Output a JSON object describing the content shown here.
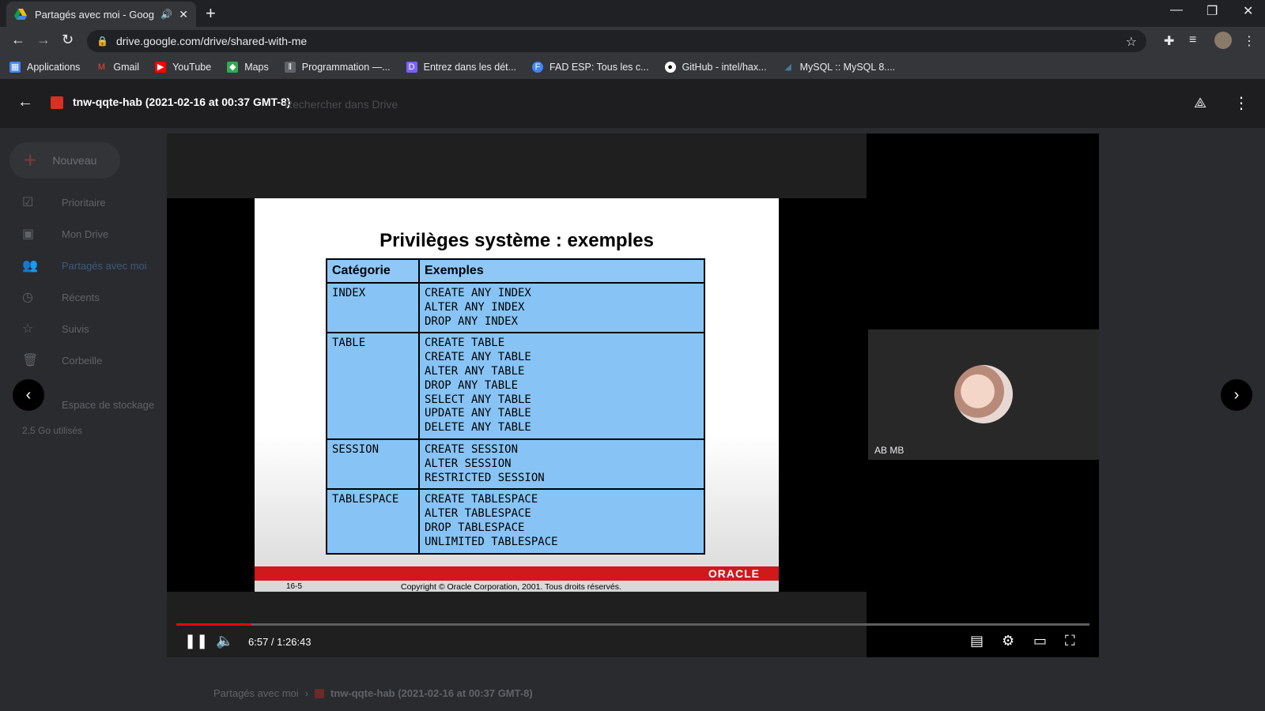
{
  "browser": {
    "tab_title": "Partagés avec moi - Google Drive",
    "url": "drive.google.com/drive/shared-with-me",
    "bookmarks": [
      {
        "label": "Applications",
        "icon": "apps-grid-icon",
        "color": "#ea4335"
      },
      {
        "label": "Gmail",
        "icon": "gmail-icon",
        "color": "#ea4335"
      },
      {
        "label": "YouTube",
        "icon": "youtube-icon",
        "color": "#ff0000"
      },
      {
        "label": "Maps",
        "icon": "maps-icon",
        "color": "#34a853"
      },
      {
        "label": "Programmation —...",
        "icon": "bookmark-icon",
        "color": "#9aa0a6"
      },
      {
        "label": "Entrez dans les dét...",
        "icon": "discord-icon",
        "color": "#7b61ff"
      },
      {
        "label": "FAD ESP: Tous les c...",
        "icon": "fad-icon",
        "color": "#4285f4"
      },
      {
        "label": "GitHub - intel/hax...",
        "icon": "github-icon",
        "color": "#ffffff"
      },
      {
        "label": "MySQL :: MySQL 8....",
        "icon": "mysql-icon",
        "color": "#4479a1"
      }
    ]
  },
  "drive": {
    "new_button": "Nouveau",
    "nav": [
      {
        "label": "Prioritaire",
        "icon": "check-circle-icon"
      },
      {
        "label": "Mon Drive",
        "icon": "drive-icon"
      },
      {
        "label": "Partagés avec moi",
        "icon": "people-icon"
      },
      {
        "label": "Récents",
        "icon": "clock-icon"
      },
      {
        "label": "Suivis",
        "icon": "star-icon"
      },
      {
        "label": "Corbeille",
        "icon": "trash-icon"
      },
      {
        "label": "Espace de stockage",
        "icon": "cloud-icon"
      }
    ],
    "storage_used": "2,5 Go utilisés",
    "search_ghost": "Rechercher dans Drive",
    "breadcrumb_root": "Partagés avec moi",
    "breadcrumb_current": "tnw-qqte-hab (2021-02-16 at 00:37 GMT-8)"
  },
  "viewer": {
    "filename": "tnw-qqte-hab (2021-02-16 at 00:37 GMT-8)"
  },
  "video": {
    "time_display": "6:57 / 1:26:43",
    "progress_fraction": 0.082,
    "participant_name": "AB MB",
    "slide": {
      "title": "Privilèges système : exemples",
      "headers": [
        "Catégorie",
        "Exemples"
      ],
      "rows": [
        {
          "category": "INDEX",
          "examples": [
            "CREATE ANY INDEX",
            "ALTER ANY INDEX",
            "DROP ANY INDEX"
          ]
        },
        {
          "category": "TABLE",
          "examples": [
            "CREATE TABLE",
            "CREATE ANY TABLE",
            "ALTER ANY TABLE",
            "DROP ANY TABLE",
            "SELECT ANY TABLE",
            "UPDATE ANY TABLE",
            "DELETE ANY TABLE"
          ]
        },
        {
          "category": "SESSION",
          "examples": [
            "CREATE SESSION",
            "ALTER SESSION",
            "RESTRICTED SESSION"
          ]
        },
        {
          "category": "TABLESPACE",
          "examples": [
            "CREATE TABLESPACE",
            "ALTER TABLESPACE",
            "DROP TABLESPACE",
            "UNLIMITED TABLESPACE"
          ]
        }
      ],
      "brand": "ORACLE",
      "slide_number": "16-5",
      "copyright": "Copyright © Oracle Corporation, 2001. Tous droits réservés."
    }
  }
}
